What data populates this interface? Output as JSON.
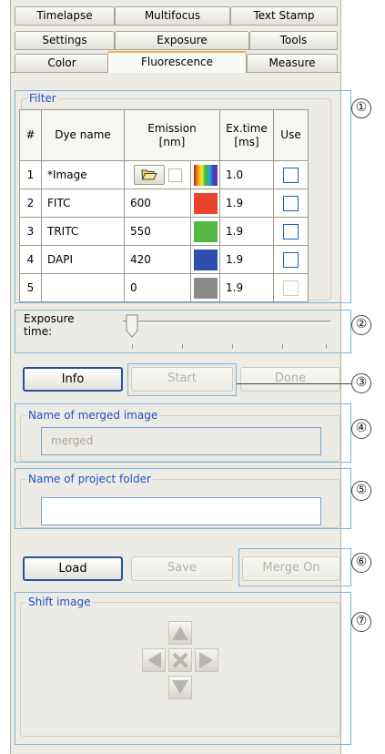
{
  "tabs": {
    "row1": [
      "Timelapse",
      "Multifocus",
      "Text Stamp"
    ],
    "row2": [
      "Settings",
      "Exposure",
      "Tools"
    ],
    "row3": [
      "Color",
      "Fluorescence",
      "Measure"
    ],
    "active": "Fluorescence"
  },
  "filter": {
    "title": "Filter",
    "headers": {
      "num": "#",
      "dye_name": "Dye name",
      "emission": "Emission\n[nm]",
      "ex_time": "Ex.time\n[ms]",
      "use": "Use"
    },
    "rows": [
      {
        "num": "1",
        "dye": "*Image",
        "emission": "",
        "color_icon": "rainbow-gradient",
        "ex_time": "1.0",
        "use": false
      },
      {
        "num": "2",
        "dye": "FITC",
        "emission": "600",
        "color": "#e8432c",
        "ex_time": "1.9",
        "use": false
      },
      {
        "num": "3",
        "dye": "TRITC",
        "emission": "550",
        "color": "#52b745",
        "ex_time": "1.9",
        "use": false
      },
      {
        "num": "4",
        "dye": "DAPI",
        "emission": "420",
        "color": "#2f4fb0",
        "ex_time": "1.9",
        "use": false
      },
      {
        "num": "5",
        "dye": "",
        "emission": "0",
        "color": "#8a8a8a",
        "ex_time": "1.9",
        "use": false
      }
    ]
  },
  "exposure": {
    "label": "Exposure\ntime:",
    "slider_position": 0.0
  },
  "buttons": {
    "info": "Info",
    "start": "Start",
    "done": "Done",
    "load": "Load",
    "save": "Save",
    "merge_on": "Merge On"
  },
  "merged_image": {
    "title": "Name of merged image",
    "value": "merged"
  },
  "project_folder": {
    "title": "Name of project folder",
    "value": ""
  },
  "shift_image": {
    "title": "Shift image"
  },
  "callouts": [
    "①",
    "②",
    "③",
    "④",
    "⑤",
    "⑥",
    "⑦"
  ],
  "colors": {
    "accent": "#2450c8",
    "active_tab_marker": "#f2b34a",
    "callout_outline": "#7fb3d6"
  },
  "icons": {
    "open": "folder-open-icon",
    "shift_up": "arrow-up-icon",
    "shift_left": "arrow-left-icon",
    "shift_center": "center-x-icon",
    "shift_right": "arrow-right-icon",
    "shift_down": "arrow-down-icon"
  }
}
